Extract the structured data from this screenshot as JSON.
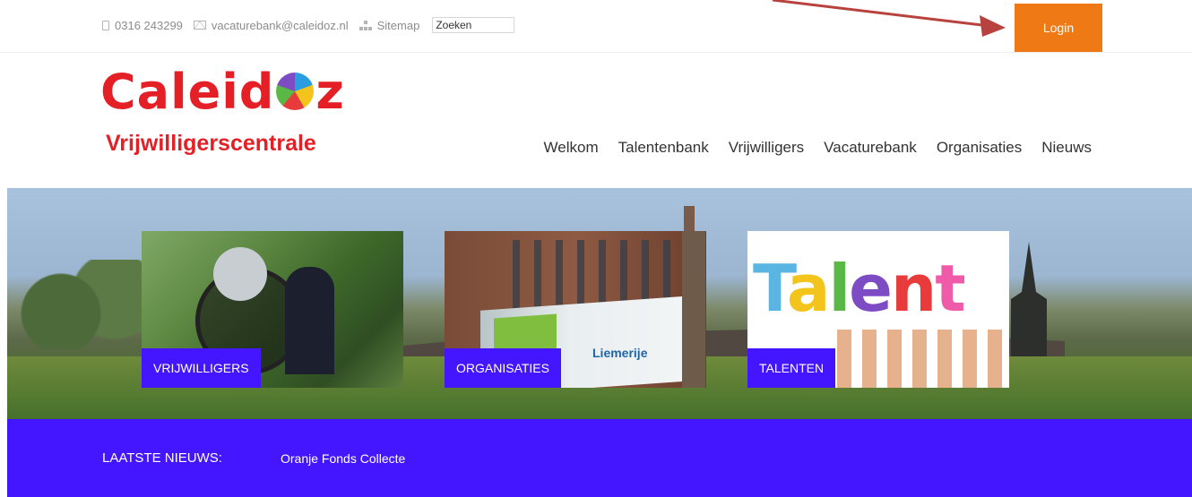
{
  "topbar": {
    "phone": "0316 243299",
    "email": "vacaturebank@caleidoz.nl",
    "sitemap": "Sitemap",
    "search_placeholder": "Zoeken",
    "login_label": "Login"
  },
  "header": {
    "logo_word_a": "Caleid",
    "logo_word_b": "z",
    "logo_subtitle": "Vrijwilligerscentrale",
    "nav": [
      "Welkom",
      "Talentenbank",
      "Vrijwilligers",
      "Vacaturebank",
      "Organisaties",
      "Nieuws"
    ]
  },
  "banner": {
    "cards": [
      {
        "label": "VRIJWILLIGERS"
      },
      {
        "label": "ORGANISATIES",
        "sign_text": "Liemerije"
      },
      {
        "label": "TALENTEN",
        "image_word": [
          "T",
          "a",
          "l",
          "e",
          "n",
          "t"
        ]
      }
    ]
  },
  "news": {
    "title": "LAATSTE NIEUWS:",
    "item": "Oranje Fonds Collecte"
  },
  "colors": {
    "accent_purple": "#4416ff",
    "login_orange": "#ef7a15",
    "logo_red": "#e41f26",
    "annotation_arrow": "#b8433e"
  }
}
